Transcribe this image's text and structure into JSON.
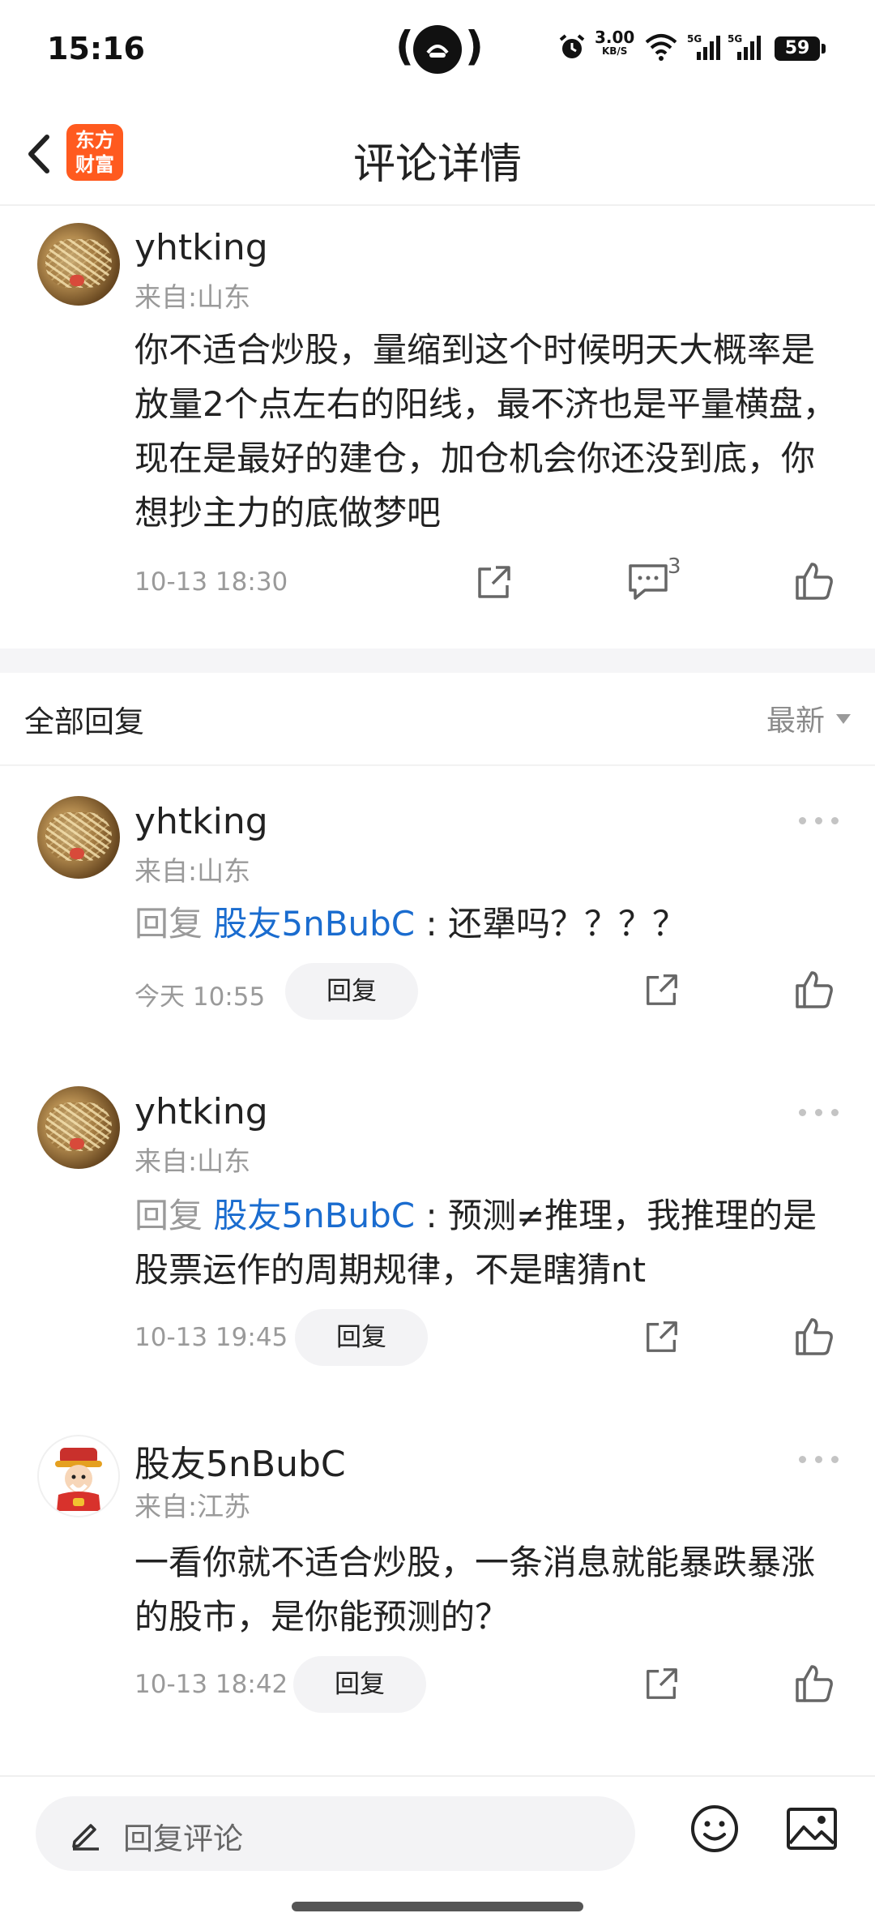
{
  "status_bar": {
    "time": "15:16",
    "net_speed": "3.00",
    "net_unit": "KB/S",
    "signal1": "5G",
    "signal2": "5G",
    "battery": "59"
  },
  "header": {
    "logo_line1": "东方",
    "logo_line2": "财富",
    "title": "评论详情"
  },
  "main_comment": {
    "username": "yhtking",
    "location": "来自:山东",
    "body": "你不适合炒股，量缩到这个时候明天大概率是放量2个点左右的阳线，最不济也是平量横盘，现在是最好的建仓，加仓机会你还没到底，你想抄主力的底做梦吧",
    "timestamp": "10-13 18:30",
    "comment_count": "3"
  },
  "replies_section": {
    "title": "全部回复",
    "sort": "最新"
  },
  "replies": [
    {
      "username": "yhtking",
      "location": "来自:山东",
      "prefix": "回复 ",
      "mention": "股友5nBubC",
      "text": " : 还犟吗？？？？",
      "timestamp": "今天 10:55",
      "reply_label": "回复"
    },
    {
      "username": "yhtking",
      "location": "来自:山东",
      "prefix": "回复 ",
      "mention": "股友5nBubC",
      "text": " : 预测≠推理，我推理的是",
      "text2": "股票运作的周期规律，不是瞎猜nt",
      "timestamp": "10-13 19:45",
      "reply_label": "回复"
    },
    {
      "username": "股友5nBubC",
      "location": "来自:江苏",
      "text": "一看你就不适合炒股，一条消息就能暴跌暴涨的股市，是你能预测的？",
      "timestamp": "10-13 18:42",
      "reply_label": "回复"
    }
  ],
  "bottom_bar": {
    "input_placeholder": "回复评论"
  }
}
